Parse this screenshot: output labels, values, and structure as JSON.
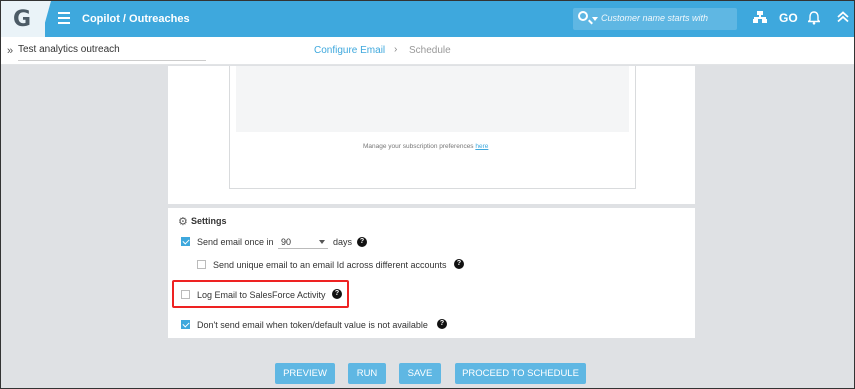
{
  "header": {
    "logo_letter": "G",
    "breadcrumb": "Copilot / Outreaches",
    "search_placeholder": "Customer name starts with",
    "go_label": "GO",
    "accent_color": "#3ea8dd"
  },
  "subheader": {
    "outreach_name": "Test analytics outreach",
    "tabs": [
      {
        "label": "Configure Email"
      },
      {
        "label": "Schedule"
      }
    ],
    "separator": "›"
  },
  "email_preview": {
    "manage_text": "Manage your subscription preferences",
    "manage_link": "here"
  },
  "settings": {
    "title": "Settings",
    "send_once_label": "Send email once in",
    "send_once_days_value": "90",
    "days_label": "days",
    "unique_email_label": "Send unique email to an email Id across different accounts",
    "log_email_label": "Log Email to SalesForce Activity",
    "no_default_label": "Don't send email when token/default value is not available",
    "help_glyph": "?"
  },
  "actions": {
    "preview": "PREVIEW",
    "run": "RUN",
    "save": "SAVE",
    "proceed": "PROCEED TO SCHEDULE"
  }
}
